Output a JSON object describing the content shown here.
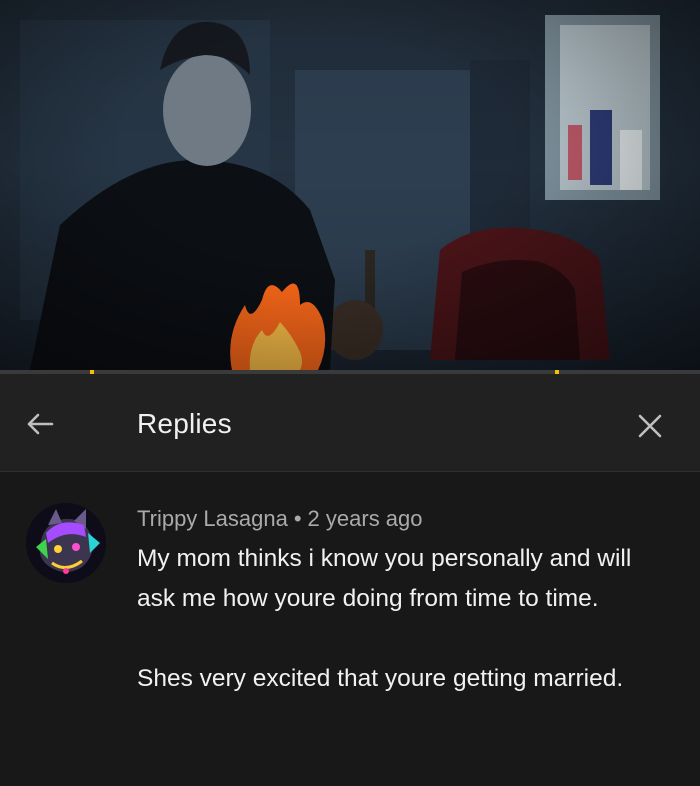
{
  "video": {
    "progress_fraction": 0.0,
    "progress_color": "#ff0000",
    "marker_color": "#f2c200"
  },
  "header": {
    "title": "Replies",
    "back_icon": "arrow-left-icon",
    "close_icon": "close-icon"
  },
  "comment": {
    "author": "Trippy Lasagna",
    "separator": "•",
    "time": "2 years ago",
    "paragraphs": [
      "My mom thinks i know you personally and will ask me how youre doing from time to time.",
      "Shes very excited that youre getting married."
    ]
  },
  "colors": {
    "panel_bg": "#181818",
    "header_bg": "#212121",
    "text_primary": "#f1f1f1",
    "text_secondary": "#aaaaaa"
  }
}
